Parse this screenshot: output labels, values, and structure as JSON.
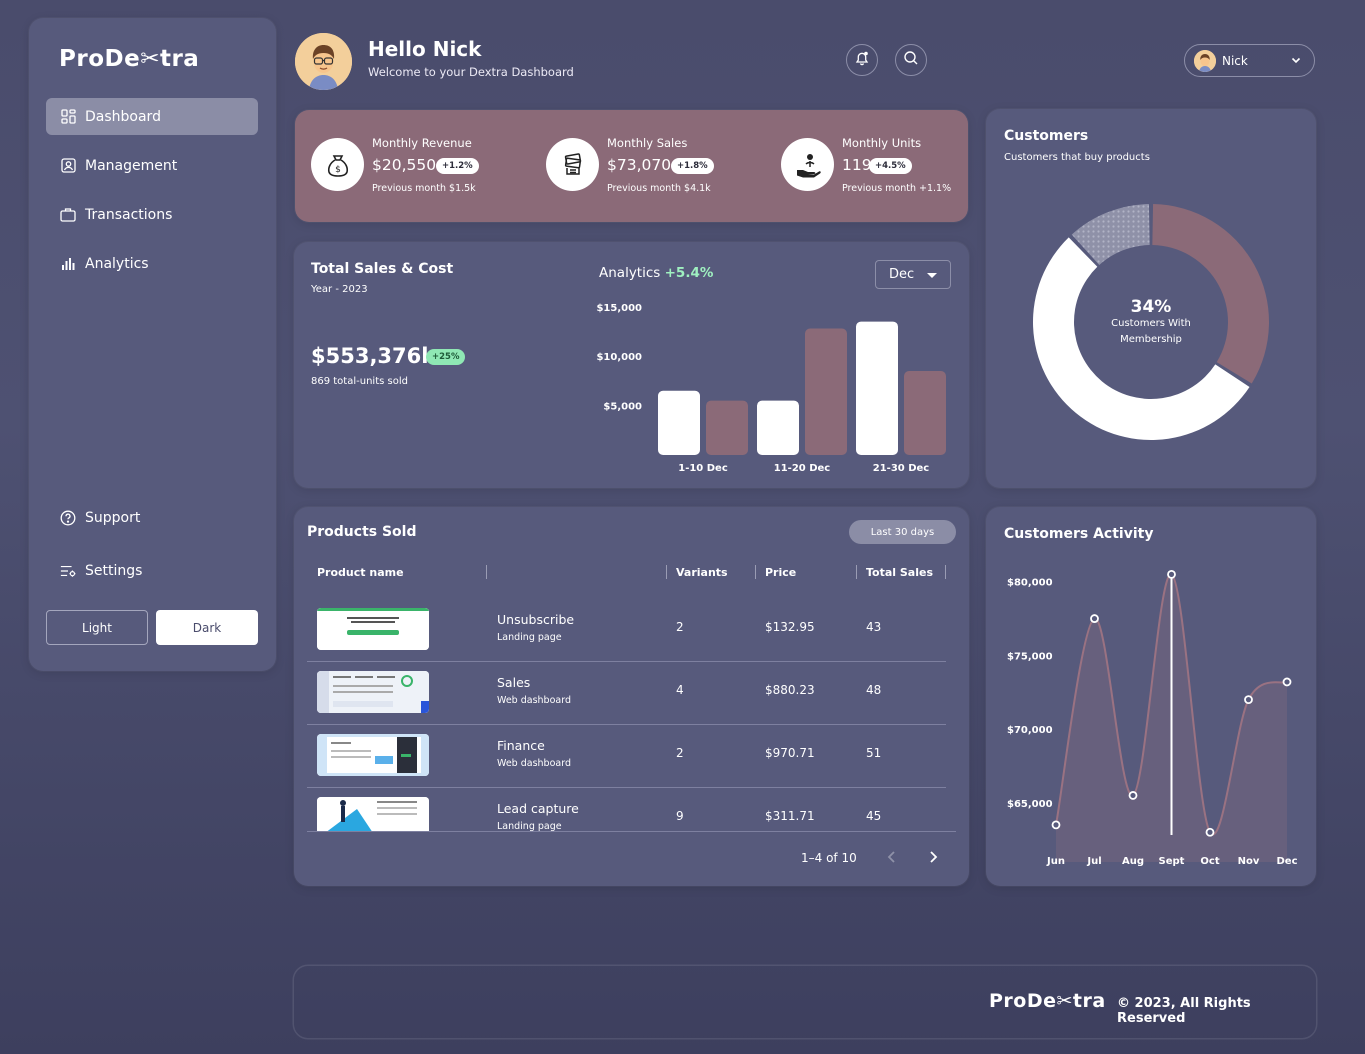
{
  "brand": {
    "logo_text": "ProDe✂tra"
  },
  "sidebar": {
    "items": [
      {
        "label": "Dashboard",
        "icon": "dashboard-icon",
        "active": true
      },
      {
        "label": "Management",
        "icon": "management-icon"
      },
      {
        "label": "Transactions",
        "icon": "briefcase-icon"
      },
      {
        "label": "Analytics",
        "icon": "bar-chart-icon"
      }
    ],
    "bottom_items": [
      {
        "label": "Support",
        "icon": "help-circle-icon"
      },
      {
        "label": "Settings",
        "icon": "settings-icon"
      }
    ],
    "theme": {
      "light_label": "Light",
      "dark_label": "Dark",
      "selected": "Dark"
    }
  },
  "header": {
    "greeting": "Hello Nick",
    "subtitle": "Welcome to your Dextra Dashboard",
    "user_name": "Nick"
  },
  "stats": [
    {
      "label": "Monthly Revenue",
      "value": "$20,550",
      "badge": "+1.2%",
      "prev": "Previous month $1.5k",
      "icon": "money-bag-icon"
    },
    {
      "label": "Monthly Sales",
      "value": "$73,070",
      "badge": "+1.8%",
      "prev": "Previous month $4.1k",
      "icon": "cash-stack-icon"
    },
    {
      "label": "Monthly Units",
      "value": "119",
      "badge": "+4.5%",
      "prev": "Previous month +1.1%",
      "icon": "hand-coins-icon"
    }
  ],
  "sales_card": {
    "title": "Total Sales & Cost",
    "year": "Year - 2023",
    "total": "$553,376k",
    "total_badge": "+25%",
    "units": "869 total-units sold",
    "analytics_label": "Analytics",
    "analytics_pct": "+5.4%",
    "period_select": "Dec"
  },
  "customers_card": {
    "title": "Customers",
    "subtitle": "Customers that buy products",
    "center_value": "34%",
    "center_label_1": "Customers With",
    "center_label_2": "Membership"
  },
  "products": {
    "title": "Products Sold",
    "range_button": "Last 30 days",
    "columns": [
      "Product name",
      "Variants",
      "Price",
      "Total Sales"
    ],
    "rows": [
      {
        "name": "Unsubscribe",
        "type": "Landing page",
        "variants": "2",
        "price": "$132.95",
        "total": "43"
      },
      {
        "name": "Sales",
        "type": "Web dashboard",
        "variants": "4",
        "price": "$880.23",
        "total": "48"
      },
      {
        "name": "Finance",
        "type": "Web dashboard",
        "variants": "2",
        "price": "$970.71",
        "total": "51"
      },
      {
        "name": "Lead capture",
        "type": "Landing page",
        "variants": "9",
        "price": "$311.71",
        "total": "45"
      }
    ],
    "pager": "1–4 of 10"
  },
  "activity_card": {
    "title": "Customers Activity"
  },
  "footer": {
    "copyright": "© 2023, All Rights Reserved"
  },
  "colors": {
    "accent": "#8b6a78",
    "panel": "#575a7c",
    "badge_green": "#8fe8b4",
    "bar_light": "#ffffff"
  },
  "chart_data": [
    {
      "type": "bar",
      "categories": [
        "1-10 Dec",
        "11-20 Dec",
        "21-30 Dec"
      ],
      "series": [
        {
          "values": [
            6500,
            5500,
            13500
          ]
        },
        {
          "values": [
            5500,
            12800,
            8500
          ]
        }
      ],
      "ytick_labels": [
        "$5,000",
        "$10,000",
        "$15,000"
      ],
      "yticks": [
        5000,
        10000,
        15000
      ],
      "ylim": [
        0,
        17000
      ],
      "grid": false
    },
    {
      "type": "pie",
      "categories": [
        "segment-rose",
        "segment-white",
        "segment-pattern"
      ],
      "values": [
        34,
        54,
        12
      ],
      "colors": [
        "#8b6a78",
        "#ffffff",
        "#8f91a8"
      ]
    },
    {
      "type": "area",
      "x": [
        "Jun",
        "Jul",
        "Aug",
        "Sept",
        "Oct",
        "Nov",
        "Dec"
      ],
      "y": [
        63500,
        77500,
        65500,
        80500,
        63000,
        72000,
        73200
      ],
      "ytick_labels": [
        "$65,000",
        "$70,000",
        "$75,000",
        "$80,000"
      ],
      "yticks": [
        65000,
        70000,
        75000,
        80000
      ],
      "highlight": "Sept",
      "grid": false
    }
  ]
}
